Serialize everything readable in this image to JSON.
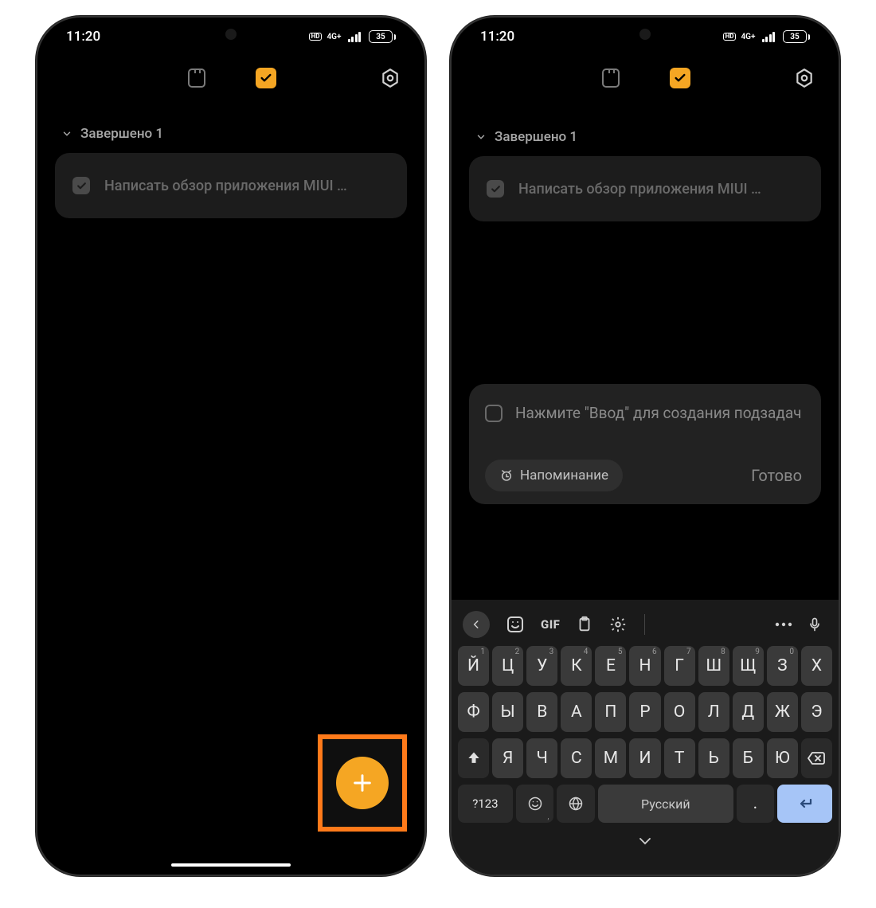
{
  "status": {
    "time": "11:20",
    "net_badge": "HD",
    "net_label": "4G+",
    "battery": "35"
  },
  "tabs": {
    "notes": "notes",
    "tasks": "tasks"
  },
  "section": {
    "completed_label": "Завершено 1"
  },
  "task": {
    "text": "Написать обзор приложения MIUI …"
  },
  "fab": {
    "plus": "+"
  },
  "editor": {
    "placeholder": "Нажмите \"Ввод\" для создания подзадач",
    "reminder": "Напоминание",
    "done": "Готово"
  },
  "keyboard": {
    "gif": "GIF",
    "row1": [
      {
        "l": "Й",
        "n": "1"
      },
      {
        "l": "Ц",
        "n": "2"
      },
      {
        "l": "У",
        "n": "3"
      },
      {
        "l": "К",
        "n": "4"
      },
      {
        "l": "Е",
        "n": "5"
      },
      {
        "l": "Н",
        "n": "6"
      },
      {
        "l": "Г",
        "n": "7"
      },
      {
        "l": "Ш",
        "n": "8"
      },
      {
        "l": "Щ",
        "n": "9"
      },
      {
        "l": "З",
        "n": "0"
      },
      {
        "l": "Х",
        "n": ""
      }
    ],
    "row2": [
      "Ф",
      "Ы",
      "В",
      "А",
      "П",
      "Р",
      "О",
      "Л",
      "Д",
      "Ж",
      "Э"
    ],
    "row3": [
      "Я",
      "Ч",
      "С",
      "М",
      "И",
      "Т",
      "Ь",
      "Б",
      "Ю"
    ],
    "sym": "?123",
    "space": "Русский",
    "period": "."
  }
}
